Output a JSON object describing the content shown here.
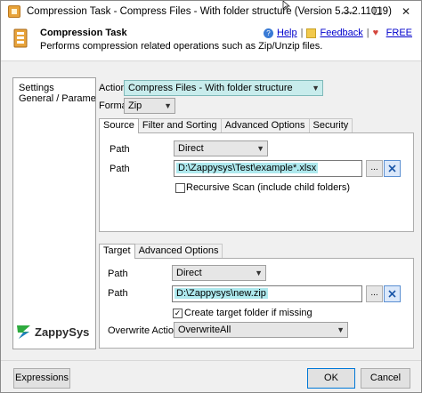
{
  "window": {
    "title": "Compression Task - Compress Files - With folder structure (Version 5.3.2.11019)",
    "minimize": "—",
    "maximize": "☐",
    "close": "✕"
  },
  "header": {
    "task_name": "Compression Task",
    "description": "Performs compression related operations such as Zip/Unzip files.",
    "links": {
      "help": "Help",
      "feedback": "Feedback",
      "free": "FREE",
      "separator": "|"
    }
  },
  "sidebar": {
    "items": [
      "Settings",
      "General / Parameters"
    ]
  },
  "logo": {
    "text": "ZappySys"
  },
  "settings": {
    "action_label": "Action",
    "action_value": "Compress Files - With folder structure",
    "format_label": "Format",
    "format_value": "Zip"
  },
  "source": {
    "tabs": [
      "Source",
      "Filter and Sorting",
      "Advanced Options",
      "Security"
    ],
    "path_type_label": "Path",
    "path_type_value": "Direct",
    "path_label": "Path",
    "path_value": "D:\\Zappysys\\Test\\example*.xlsx",
    "browse_label": "...",
    "recursive_label": "Recursive Scan (include child folders)",
    "recursive_checked": false
  },
  "target": {
    "tabs": [
      "Target",
      "Advanced Options"
    ],
    "path_type_label": "Path",
    "path_type_value": "Direct",
    "path_label": "Path",
    "path_value": "D:\\Zappysys\\new.zip",
    "browse_label": "...",
    "create_folder_label": "Create target folder if missing",
    "create_folder_checked": true,
    "overwrite_label": "Overwrite Action",
    "overwrite_value": "OverwriteAll"
  },
  "footer": {
    "expressions": "Expressions",
    "ok": "OK",
    "cancel": "Cancel"
  },
  "colors": {
    "link": "#0000cc",
    "selected_combo": "#c8ecec",
    "path_highlight": "#aee9ee",
    "accent_button": "#0078d7"
  }
}
